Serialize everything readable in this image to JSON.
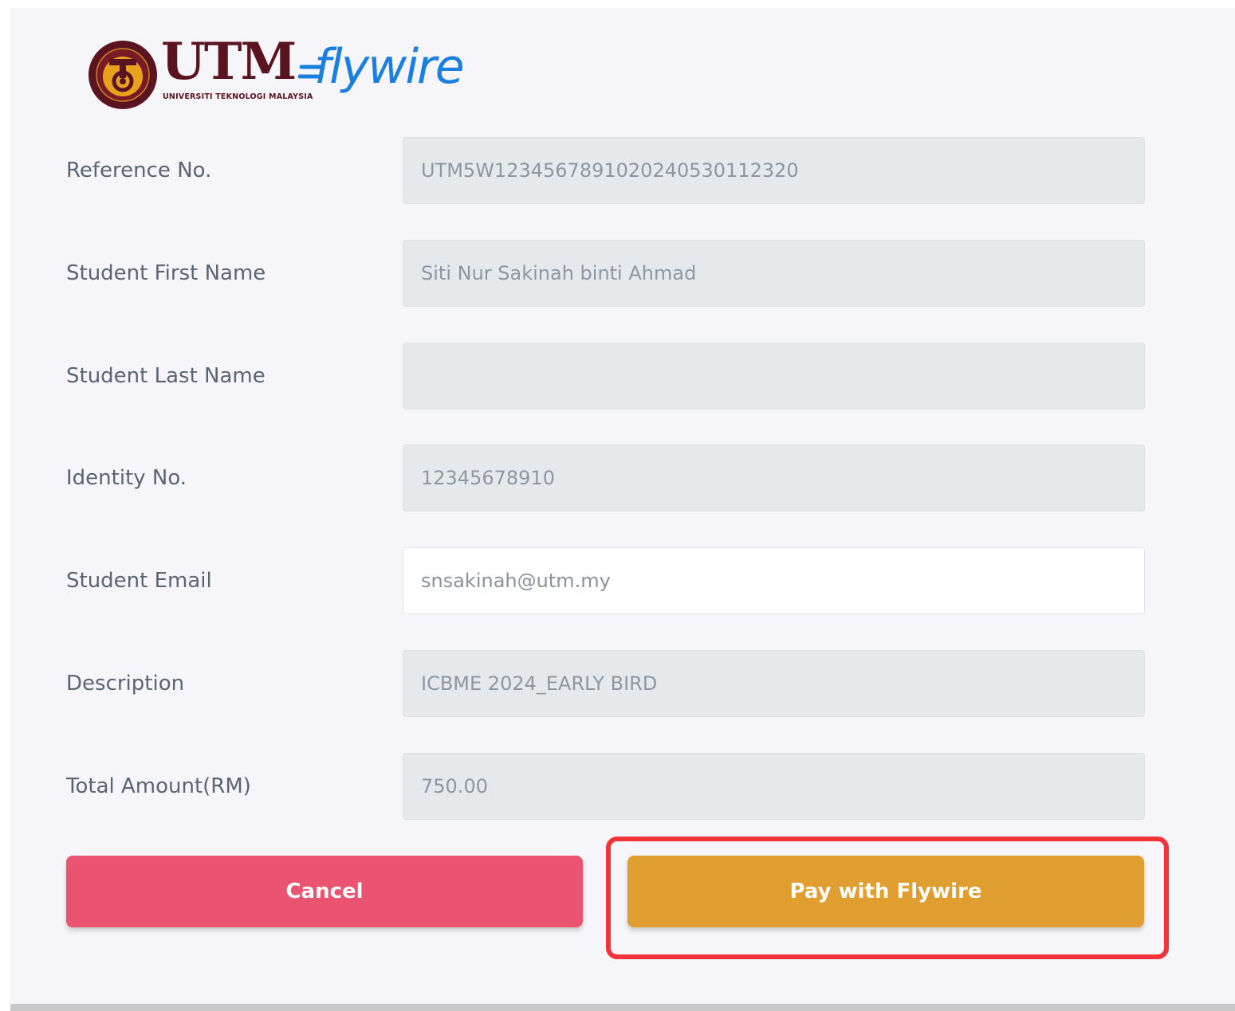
{
  "logo": {
    "utm_text": "UTM",
    "utm_subtitle": "UNIVERSITI TEKNOLOGI MALAYSIA",
    "flywire_text": "flywire",
    "colors": {
      "utm": "#5a1420",
      "flywire": "#1b7fe0",
      "seal_gold": "#e8a21c"
    }
  },
  "form": {
    "reference_no": {
      "label": "Reference No.",
      "value": "UTM5W12345678910202405301123​20"
    },
    "first_name": {
      "label": "Student First Name",
      "value": "Siti Nur Sakinah binti Ahmad"
    },
    "last_name": {
      "label": "Student Last Name",
      "value": ""
    },
    "identity_no": {
      "label": "Identity No.",
      "value": "12345678910"
    },
    "email": {
      "label": "Student Email",
      "value": "snsakinah@utm.my"
    },
    "description": {
      "label": "Description",
      "value": "ICBME 2024_EARLY BIRD"
    },
    "total_amount": {
      "label": "Total Amount(RM)",
      "value": "750.00"
    }
  },
  "buttons": {
    "cancel_label": "Cancel",
    "pay_label": "Pay with Flywire"
  },
  "colors": {
    "cancel": "#ea5470",
    "pay": "#e09d30",
    "highlight": "#f3333a",
    "readonly_field": "#e5e9ec"
  }
}
